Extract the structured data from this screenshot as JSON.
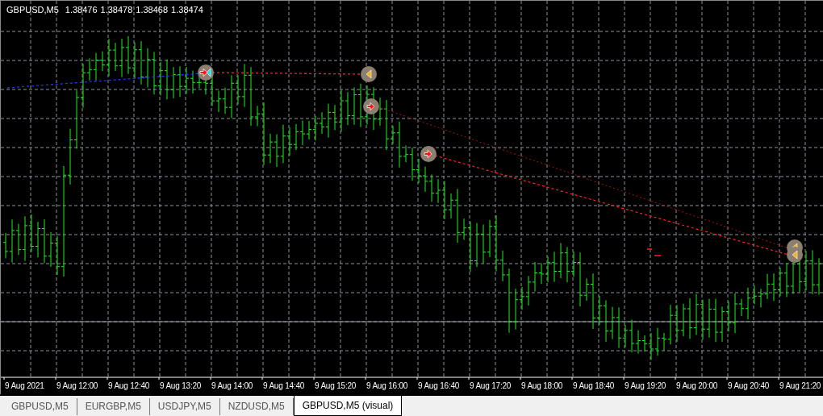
{
  "chart": {
    "symbol": "GBPUSD,M5",
    "quotes": [
      "1.38476",
      "1.38478",
      "1.38468",
      "1.38474"
    ],
    "x_labels": [
      "9 Aug 2021",
      "9 Aug 12:00",
      "9 Aug 12:40",
      "9 Aug 13:20",
      "9 Aug 14:00",
      "9 Aug 14:40",
      "9 Aug 15:20",
      "9 Aug 16:00",
      "9 Aug 16:40",
      "9 Aug 17:20",
      "9 Aug 18:00",
      "9 Aug 18:40",
      "9 Aug 19:20",
      "9 Aug 20:00",
      "9 Aug 20:40",
      "9 Aug 21:20"
    ]
  },
  "tabs": [
    {
      "label": "GBPUSD,M5",
      "selected": false
    },
    {
      "label": "EURGBP,M5",
      "selected": false
    },
    {
      "label": "USDJPY,M5",
      "selected": false
    },
    {
      "label": "NZDUSD,M5",
      "selected": false
    },
    {
      "label": "GBPUSD,M5 (visual)",
      "selected": true
    }
  ]
}
